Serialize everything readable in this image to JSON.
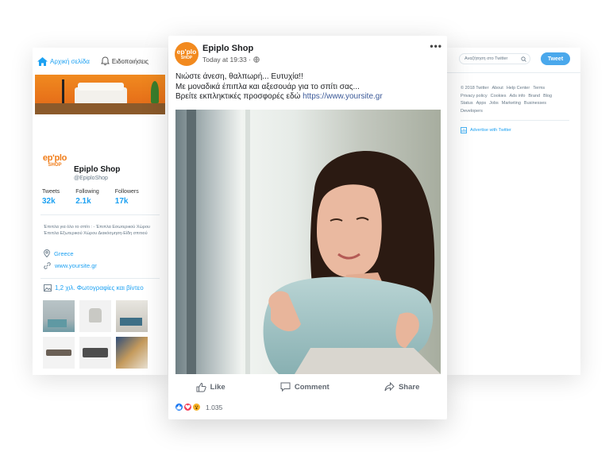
{
  "twitter_left": {
    "nav": {
      "home_label": "Αρχική σελίδα",
      "notifications_label": "Ειδοποιήσεις"
    },
    "logo": {
      "line1": "ep'plo",
      "line2": "SHOP"
    },
    "profile": {
      "name": "Epiplo Shop",
      "handle": "@EpiploShop"
    },
    "stats": [
      {
        "label": "Tweets",
        "value": "32k"
      },
      {
        "label": "Following",
        "value": "2.1k"
      },
      {
        "label": "Followers",
        "value": "17k"
      }
    ],
    "bio": "Έπιπλα για όλο το σπίτι : - Έπιπλα Εσωτερικού Χώρου Έπιπλα Εξωτερικού Χώρου Διακόσμηση-Είδη σπιτιού",
    "location": "Greece",
    "website": "www.yoursite.gr",
    "photos_label": "1,2 χιλ. Φωτογραφίες και βίντεο"
  },
  "twitter_right": {
    "search_placeholder": "Αναζήτηση στο Twitter",
    "tweet_button": "Tweet",
    "footer_links": [
      "© 2018 Twitter",
      "About",
      "Help Center",
      "Terms",
      "Privacy policy",
      "Cookies",
      "Ads info",
      "Brand",
      "Blog",
      "Status",
      "Apps",
      "Jobs",
      "Marketing",
      "Businesses",
      "Developers"
    ],
    "advertise": "Advertise with Twitter"
  },
  "facebook_post": {
    "avatar": {
      "line1": "ep'plo",
      "line2": "SHOP"
    },
    "page_name": "Epiplo Shop",
    "timestamp": "Today at 19:33 ·",
    "text_line1": "Νιώστε άνεση, θαλπωρή... Ευτυχία!!",
    "text_line2": "Με μοναδικά έπιπλα και αξεσουάρ για το σπίτι σας...",
    "text_line3_prefix": "Βρείτε εκπληκτικές προσφορές εδώ ",
    "text_link": "https://www.yoursite.gr",
    "actions": {
      "like": "Like",
      "comment": "Comment",
      "share": "Share"
    },
    "reaction_count": "1.035"
  },
  "colors": {
    "twitter_blue": "#1da1f2",
    "brand_orange": "#f28a1f",
    "facebook_link": "#3b5998",
    "like_blue": "#1877f2",
    "love_red": "#f33e58",
    "wow_yellow": "#f7b125"
  },
  "icons": {
    "home": "home-icon",
    "notifications": "bell-icon",
    "location": "location-pin-icon",
    "link": "link-icon",
    "photos": "image-icon",
    "search": "search-icon",
    "advertise": "chart-icon",
    "globe": "globe-icon",
    "more": "more-dots-icon",
    "like": "thumbs-up-icon",
    "comment": "comment-icon",
    "share": "share-icon"
  }
}
